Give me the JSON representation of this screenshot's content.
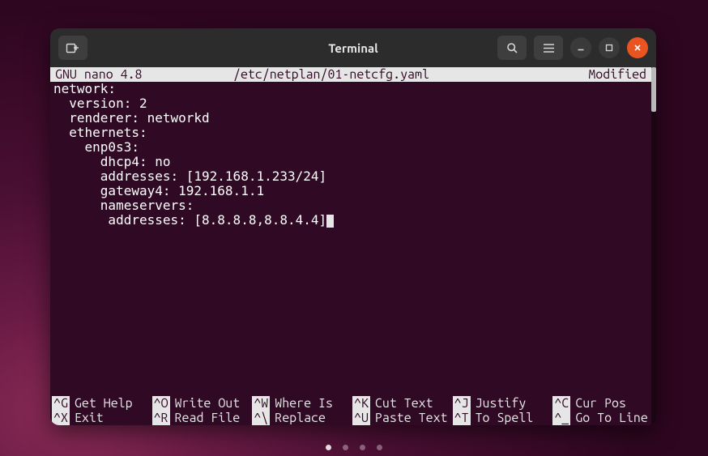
{
  "window": {
    "title": "Terminal",
    "search_tooltip": "Search",
    "menu_tooltip": "Menu"
  },
  "nano": {
    "app": "GNU nano 4.8",
    "file": "/etc/netplan/01-netcfg.yaml",
    "status": "Modified"
  },
  "lines": [
    "network:",
    "  version: 2",
    "  renderer: networkd",
    "  ethernets:",
    "    enp0s3:",
    "      dhcp4: no",
    "      addresses: [192.168.1.233/24]",
    "      gateway4: 192.168.1.1",
    "      nameservers:",
    "       addresses: [8.8.8.8,8.8.4.4]"
  ],
  "help": {
    "row1": [
      {
        "key": "^G",
        "label": "Get Help"
      },
      {
        "key": "^O",
        "label": "Write Out"
      },
      {
        "key": "^W",
        "label": "Where Is"
      },
      {
        "key": "^K",
        "label": "Cut Text"
      },
      {
        "key": "^J",
        "label": "Justify"
      },
      {
        "key": "^C",
        "label": "Cur Pos"
      }
    ],
    "row2": [
      {
        "key": "^X",
        "label": "Exit"
      },
      {
        "key": "^R",
        "label": "Read File"
      },
      {
        "key": "^\\",
        "label": "Replace"
      },
      {
        "key": "^U",
        "label": "Paste Text"
      },
      {
        "key": "^T",
        "label": "To Spell"
      },
      {
        "key": "^_",
        "label": "Go To Line"
      }
    ]
  }
}
